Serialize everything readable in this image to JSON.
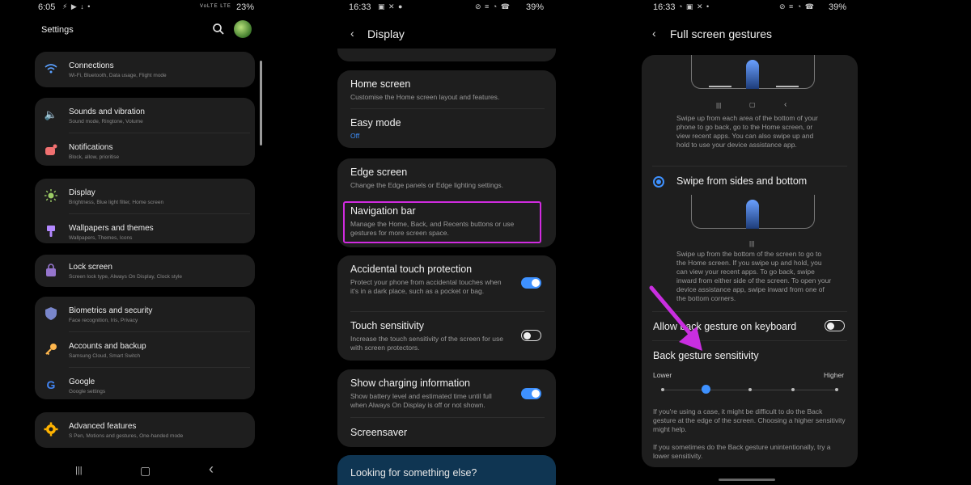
{
  "phone1": {
    "status": {
      "time": "6:05",
      "icons": "⚡ ▶ ↓ •",
      "network": "VoLTE LTE",
      "battery": "23%"
    },
    "header": {
      "title": "Settings"
    },
    "items": [
      {
        "title": "Connections",
        "subtitle": "Wi-Fi, Bluetooth, Data usage, Flight mode",
        "icon": "wifi-icon",
        "color": "#5aa0ff"
      },
      {
        "title": "Sounds and vibration",
        "subtitle": "Sound mode, Ringtone, Volume",
        "icon": "speaker-icon",
        "color": "#a78bfa"
      },
      {
        "title": "Notifications",
        "subtitle": "Block, allow, prioritise",
        "icon": "notification-icon",
        "color": "#f07070"
      },
      {
        "title": "Display",
        "subtitle": "Brightness, Blue light filter, Home screen",
        "icon": "sun-icon",
        "color": "#9ccc65"
      },
      {
        "title": "Wallpapers and themes",
        "subtitle": "Wallpapers, Themes, Icons",
        "icon": "brush-icon",
        "color": "#b388ff"
      },
      {
        "title": "Lock screen",
        "subtitle": "Screen lock type, Always On Display, Clock style",
        "icon": "lock-icon",
        "color": "#9575cd"
      },
      {
        "title": "Biometrics and security",
        "subtitle": "Face recognition, Iris, Privacy",
        "icon": "shield-icon",
        "color": "#7986cb"
      },
      {
        "title": "Accounts and backup",
        "subtitle": "Samsung Cloud, Smart Switch",
        "icon": "key-icon",
        "color": "#ffb74d"
      },
      {
        "title": "Google",
        "subtitle": "Google settings",
        "icon": "google-icon",
        "color": "#4285f4"
      },
      {
        "title": "Advanced features",
        "subtitle": "S Pen, Motions and gestures, One-handed mode",
        "icon": "gear-plus-icon",
        "color": "#ffb300"
      }
    ],
    "nav": {
      "recents": "|||",
      "home": "▢",
      "back": "‹"
    }
  },
  "phone2": {
    "status": {
      "time": "16:33",
      "icons": "▣ ✕ ●",
      "right": "⊘ ≡ ◔ ☎",
      "battery": "39%"
    },
    "header": {
      "back": "‹",
      "title": "Display"
    },
    "items": [
      {
        "title": "Home screen",
        "subtitle": "Customise the Home screen layout and features."
      },
      {
        "title": "Easy mode",
        "value": "Off"
      },
      {
        "title": "Edge screen",
        "subtitle": "Change the Edge panels or Edge lighting settings."
      },
      {
        "title": "Navigation bar",
        "subtitle": "Manage the Home, Back, and Recents buttons or use gestures for more screen space."
      },
      {
        "title": "Accidental touch protection",
        "subtitle": "Protect your phone from accidental touches when it's in a dark place, such as a pocket or bag.",
        "toggle": true
      },
      {
        "title": "Touch sensitivity",
        "subtitle": "Increase the touch sensitivity of the screen for use with screen protectors.",
        "toggle": false
      },
      {
        "title": "Show charging information",
        "subtitle": "Show battery level and estimated time until full when Always On Display is off or not shown.",
        "toggle": true
      },
      {
        "title": "Screensaver"
      }
    ],
    "looking": "Looking for something else?",
    "highlight_color": "#d12be0",
    "accent": "#3e91ff"
  },
  "phone3": {
    "status": {
      "time": "16:33",
      "icons": "◔ ▣ ✕ •",
      "right": "⊘ ≡ ◔ ☎",
      "battery": "39%"
    },
    "header": {
      "back": "‹",
      "title": "Full screen gestures"
    },
    "option1_glyphs": {
      "recents": "|||",
      "home": "▢",
      "back": "‹"
    },
    "option1_desc": "Swipe up from each area of the bottom of your phone to go back, go to the Home screen, or view recent apps. You can also swipe up and hold to use your device assistance app.",
    "option2": {
      "label": "Swipe from sides and bottom",
      "glyph": "|||",
      "selected": true
    },
    "option2_desc": "Swipe up from the bottom of the screen to go to the Home screen. If you swipe up and hold, you can view your recent apps. To go back, swipe inward from either side of the screen. To open your device assistance app, swipe inward from one of the bottom corners.",
    "keyboard_toggle": {
      "label": "Allow back gesture on keyboard",
      "value": false
    },
    "sensitivity": {
      "label": "Back gesture sensitivity",
      "lower": "Lower",
      "higher": "Higher",
      "level": 2,
      "levels": 5
    },
    "note1": "If you're using a case, it might be difficult to do the Back gesture at the edge of the screen. Choosing a higher sensitivity might help.",
    "note2": "If you sometimes do the Back gesture unintentionally, try a lower sensitivity.",
    "arrow_color": "#c92ee0"
  }
}
